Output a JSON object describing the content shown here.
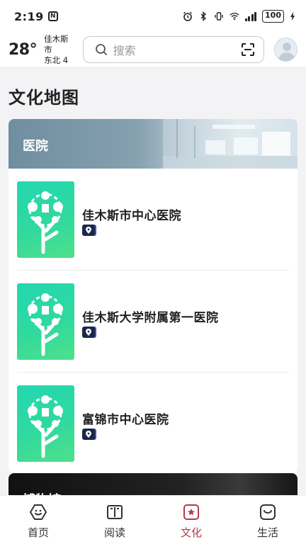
{
  "status_bar": {
    "time": "2:19",
    "notification_icon": "N",
    "battery": "100",
    "icons": [
      "alarm-icon",
      "bluetooth-icon",
      "vibrate-icon",
      "wifi-icon",
      "signal-icon",
      "charging-icon"
    ]
  },
  "header": {
    "temperature": "28°",
    "city": "佳木斯市",
    "wind": "东北 4",
    "search_placeholder": "搜索"
  },
  "page_title": "文化地图",
  "sections": [
    {
      "title": "医院",
      "items": [
        {
          "name": "佳木斯市中心医院"
        },
        {
          "name": "佳木斯大学附属第一医院"
        },
        {
          "name": "富锦市中心医院"
        }
      ]
    },
    {
      "title": "博物馆"
    }
  ],
  "bottom_nav": [
    {
      "label": "首页",
      "icon": "home-icon",
      "active": false
    },
    {
      "label": "阅读",
      "icon": "book-icon",
      "active": false
    },
    {
      "label": "文化",
      "icon": "culture-icon",
      "active": true
    },
    {
      "label": "生活",
      "icon": "life-icon",
      "active": false
    }
  ],
  "colors": {
    "accent": "#b63a4f",
    "thumb_green": "#30d99e",
    "banner_blue": "#6f8ea0"
  }
}
